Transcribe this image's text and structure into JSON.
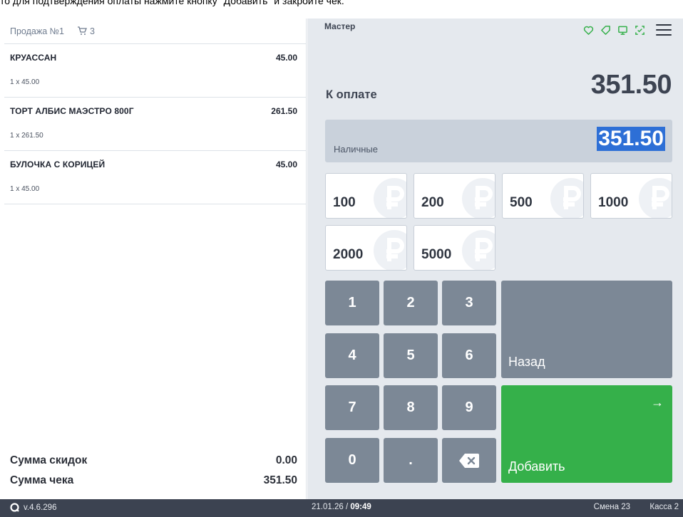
{
  "instruction": "то для подтверждения оплаты нажмите кнопку \"Добавить\" и закройте чек.",
  "sale": {
    "title": "Продажа №1",
    "cart_count": "3",
    "items": [
      {
        "name": "КРУАССАН",
        "price": "45.00",
        "qty": "1 x 45.00"
      },
      {
        "name": "ТОРТ АЛБИС МАЭСТРО 800Г",
        "price": "261.50",
        "qty": "1 x 261.50"
      },
      {
        "name": "БУЛОЧКА С КОРИЦЕЙ",
        "price": "45.00",
        "qty": "1 x 45.00"
      }
    ],
    "discount_label": "Сумма скидок",
    "discount_value": "0.00",
    "total_label": "Сумма чека",
    "total_value": "351.50"
  },
  "payment": {
    "cashier": "Мастер",
    "due_label": "К оплате",
    "due_amount": "351.50",
    "method_label": "Наличные",
    "method_amount": "351.50",
    "bills": [
      "100",
      "200",
      "500",
      "1000",
      "2000",
      "5000"
    ],
    "keys": [
      "1",
      "2",
      "3",
      "4",
      "5",
      "6",
      "7",
      "8",
      "9",
      "0",
      "."
    ],
    "back_label": "Назад",
    "add_label": "Добавить",
    "add_arrow": "→"
  },
  "status_bar": {
    "version": "v.4.6.296",
    "date": "21.01.26 /",
    "time": "09:49",
    "shift": "Смена 23",
    "register": "Касса 2"
  },
  "colors": {
    "accent_green": "#35b04a",
    "key_gray": "#7c8896",
    "status_bg": "#3c4351",
    "selection_blue": "#2d6fd6"
  },
  "icons": [
    "heart-icon",
    "tag-icon",
    "monitor-icon",
    "scan-icon",
    "menu-icon",
    "cart-icon",
    "ruble-icon",
    "backspace-icon",
    "arrow-right-icon",
    "logo-icon"
  ]
}
